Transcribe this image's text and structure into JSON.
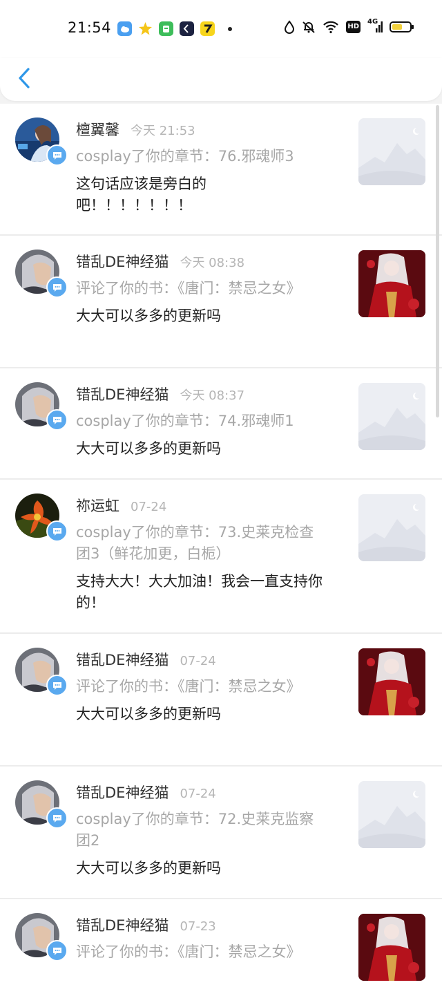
{
  "status_bar": {
    "time": "21:54",
    "network": "4G",
    "hd": "HD",
    "icons": [
      "weather-icon",
      "star-app-icon",
      "green-app-icon",
      "dark-app-icon",
      "yellow-app-icon",
      "notification-dot",
      "water-drop-icon",
      "mute-bell-icon",
      "wifi-icon",
      "hd-icon",
      "signal-icon",
      "battery-icon"
    ],
    "accent": "#2e97e8"
  },
  "nav": {
    "back_icon": "chevron-left-icon",
    "back_color": "#2e97e8"
  },
  "notifications": [
    {
      "user": "檀翼馨",
      "time": "今天 21:53",
      "action": "cosplay了你的章节：76.邪魂师3",
      "message": "这句话应该是旁白的吧！！！！！！！",
      "thumb": "placeholder"
    },
    {
      "user": "错乱DE神经猫",
      "time": "今天 08:38",
      "action": "评论了你的书：《唐门：禁忌之女》",
      "message": "大大可以多多的更新吗",
      "thumb": "cover"
    },
    {
      "user": "错乱DE神经猫",
      "time": "今天 08:37",
      "action": "cosplay了你的章节：74.邪魂师1",
      "message": "大大可以多多的更新吗",
      "thumb": "placeholder"
    },
    {
      "user": "祢运虹",
      "time": "07-24",
      "action": "cosplay了你的章节：73.史莱克检查团3（鲜花加更，白栀）",
      "message": "支持大大！大大加油！我会一直支持你的！",
      "thumb": "placeholder"
    },
    {
      "user": "错乱DE神经猫",
      "time": "07-24",
      "action": "评论了你的书：《唐门：禁忌之女》",
      "message": "大大可以多多的更新吗",
      "thumb": "cover"
    },
    {
      "user": "错乱DE神经猫",
      "time": "07-24",
      "action": "cosplay了你的章节：72.史莱克监察团2",
      "message": "大大可以多多的更新吗",
      "thumb": "placeholder"
    },
    {
      "user": "错乱DE神经猫",
      "time": "07-23",
      "action": "评论了你的书：《唐门：禁忌之女》",
      "message": "",
      "thumb": "cover"
    }
  ]
}
